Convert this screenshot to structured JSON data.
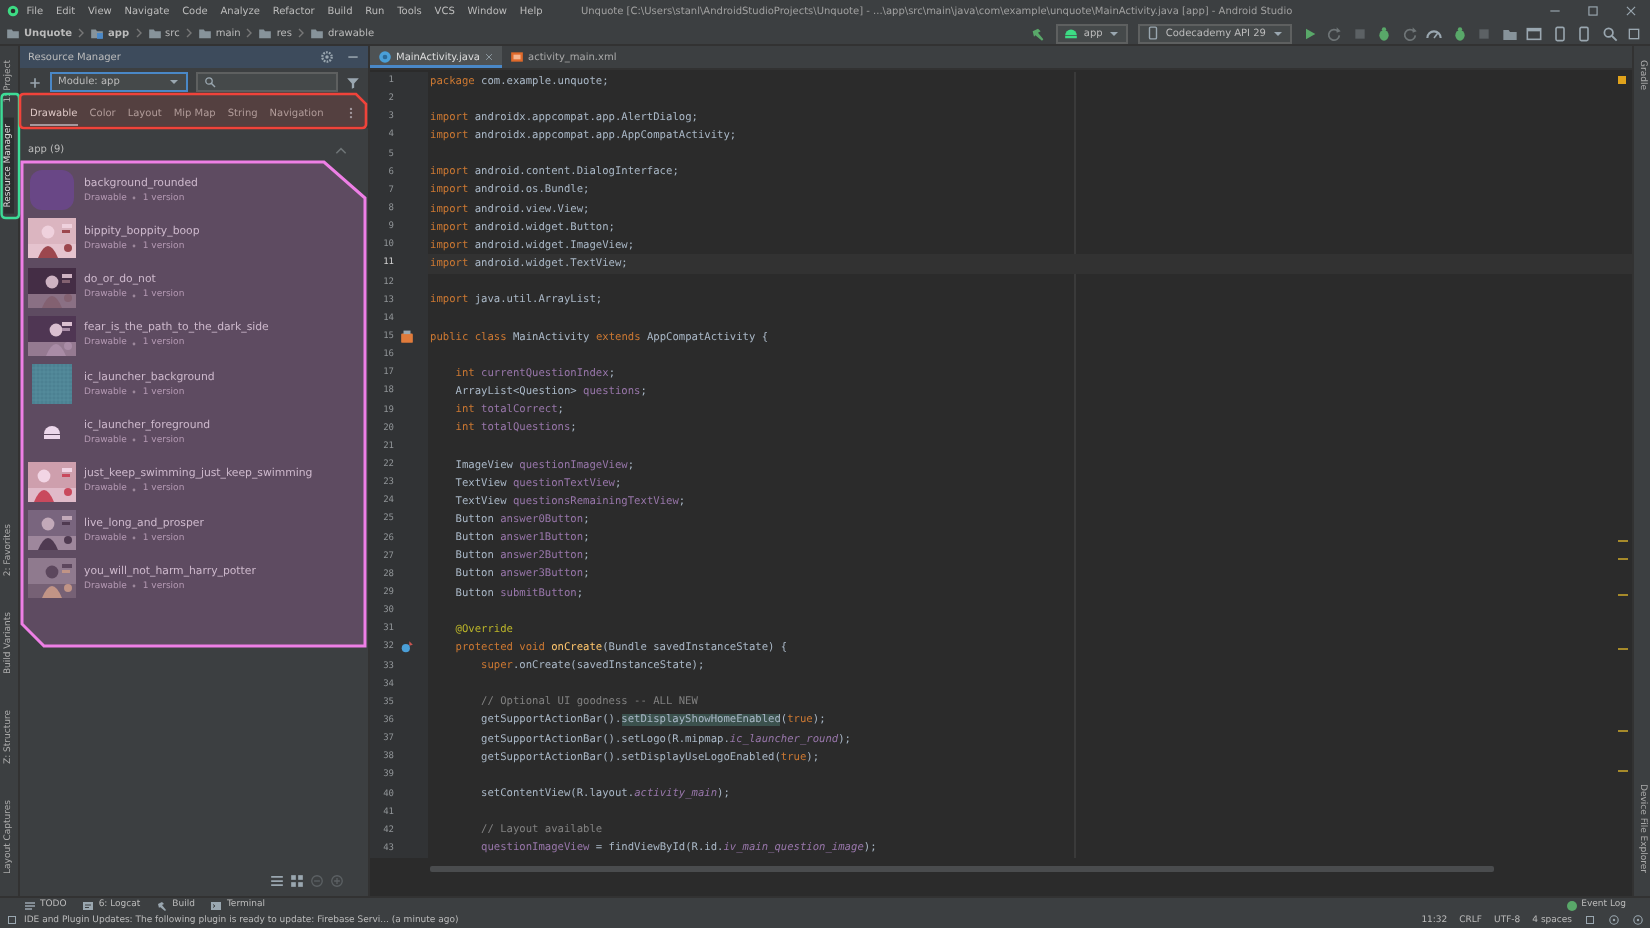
{
  "menu_bar": {
    "items": [
      "File",
      "Edit",
      "View",
      "Navigate",
      "Code",
      "Analyze",
      "Refactor",
      "Build",
      "Run",
      "Tools",
      "VCS",
      "Window",
      "Help"
    ],
    "title": "Unquote [C:\\Users\\stanl\\AndroidStudioProjects\\Unquote] - ...\\app\\src\\main\\java\\com\\example\\unquote\\MainActivity.java [app] - Android Studio"
  },
  "nav_bar": {
    "breadcrumbs": [
      {
        "label": "Unquote",
        "kind": "project"
      },
      {
        "label": "app",
        "kind": "module"
      },
      {
        "label": "src",
        "kind": "folder"
      },
      {
        "label": "main",
        "kind": "folder"
      },
      {
        "label": "res",
        "kind": "folder"
      },
      {
        "label": "drawable",
        "kind": "folder"
      }
    ],
    "run_config": "app",
    "device": "Codecademy API 29"
  },
  "left_tool_tabs": {
    "top": [
      {
        "label": "1: Project",
        "selected": false
      },
      {
        "label": "Resource Manager",
        "selected": true
      }
    ],
    "bottom": [
      {
        "label": "2: Favorites",
        "selected": false
      },
      {
        "label": "Build Variants",
        "selected": false
      },
      {
        "label": "Z: Structure",
        "selected": false
      },
      {
        "label": "Layout Captures",
        "selected": false
      }
    ]
  },
  "right_tool_tabs": {
    "top": [
      {
        "label": "Gradle"
      }
    ],
    "bottom": [
      {
        "label": "Device File Explorer"
      }
    ]
  },
  "resource_manager": {
    "title": "Resource Manager",
    "module": "Module: app",
    "tabs": [
      {
        "label": "Drawable",
        "selected": true
      },
      {
        "label": "Color",
        "selected": false
      },
      {
        "label": "Layout",
        "selected": false
      },
      {
        "label": "Mip Map",
        "selected": false
      },
      {
        "label": "String",
        "selected": false
      },
      {
        "label": "Navigation",
        "selected": false
      }
    ],
    "group": {
      "label": "app (9)",
      "expanded": true
    },
    "resources": [
      {
        "name": "background_rounded",
        "type": "Drawable",
        "versions": "1 version",
        "kind": "swatch"
      },
      {
        "name": "bippity_boppity_boop",
        "type": "Drawable",
        "versions": "1 version",
        "kind": "picture"
      },
      {
        "name": "do_or_do_not",
        "type": "Drawable",
        "versions": "1 version",
        "kind": "picture"
      },
      {
        "name": "fear_is_the_path_to_the_dark_side",
        "type": "Drawable",
        "versions": "1 version",
        "kind": "picture"
      },
      {
        "name": "ic_launcher_background",
        "type": "Drawable",
        "versions": "1 version",
        "kind": "grid"
      },
      {
        "name": "ic_launcher_foreground",
        "type": "Drawable",
        "versions": "1 version",
        "kind": "android"
      },
      {
        "name": "just_keep_swimming_just_keep_swimming",
        "type": "Drawable",
        "versions": "1 version",
        "kind": "picture"
      },
      {
        "name": "live_long_and_prosper",
        "type": "Drawable",
        "versions": "1 version",
        "kind": "picture"
      },
      {
        "name": "you_will_not_harm_harry_potter",
        "type": "Drawable",
        "versions": "1 version",
        "kind": "picture"
      }
    ]
  },
  "editor": {
    "tabs": [
      {
        "label": "MainActivity.java",
        "kind": "java",
        "selected": true
      },
      {
        "label": "activity_main.xml",
        "kind": "xml",
        "selected": false
      }
    ],
    "lines": [
      {
        "number": "1",
        "current": false,
        "segments": [
          {
            "kind": "keyword",
            "text": "package"
          },
          {
            "kind": "plain",
            "text": " com.example.unquote;"
          }
        ]
      },
      {
        "number": "2",
        "current": false
      },
      {
        "number": "3",
        "current": false,
        "segments": [
          {
            "kind": "keyword",
            "text": "import"
          },
          {
            "kind": "plain",
            "text": " androidx.appcompat.app.AlertDialog;"
          }
        ]
      },
      {
        "number": "4",
        "current": false,
        "segments": [
          {
            "kind": "keyword",
            "text": "import"
          },
          {
            "kind": "plain",
            "text": " androidx.appcompat.app.AppCompatActivity;"
          }
        ]
      },
      {
        "number": "5",
        "current": false
      },
      {
        "number": "6",
        "current": false,
        "segments": [
          {
            "kind": "keyword",
            "text": "import"
          },
          {
            "kind": "plain",
            "text": " android.content.DialogInterface;"
          }
        ]
      },
      {
        "number": "7",
        "current": false,
        "segments": [
          {
            "kind": "keyword",
            "text": "import"
          },
          {
            "kind": "plain",
            "text": " android.os.Bundle;"
          }
        ]
      },
      {
        "number": "8",
        "current": false,
        "segments": [
          {
            "kind": "keyword",
            "text": "import"
          },
          {
            "kind": "plain",
            "text": " android.view.View;"
          }
        ]
      },
      {
        "number": "9",
        "current": false,
        "segments": [
          {
            "kind": "keyword",
            "text": "import"
          },
          {
            "kind": "plain",
            "text": " android.widget.Button;"
          }
        ]
      },
      {
        "number": "10",
        "current": false,
        "segments": [
          {
            "kind": "keyword",
            "text": "import"
          },
          {
            "kind": "plain",
            "text": " android.widget.ImageView;"
          }
        ]
      },
      {
        "number": "11",
        "current": true,
        "segments": [
          {
            "kind": "keyword",
            "text": "import"
          },
          {
            "kind": "plain",
            "text": " android.widget.TextView;"
          }
        ]
      },
      {
        "number": "12",
        "current": false
      },
      {
        "number": "13",
        "current": false,
        "segments": [
          {
            "kind": "keyword",
            "text": "import"
          },
          {
            "kind": "plain",
            "text": " java.util.ArrayList;"
          }
        ]
      },
      {
        "number": "14",
        "current": false
      },
      {
        "number": "15",
        "current": false,
        "kind": "class",
        "segments": [
          {
            "kind": "keyword",
            "text": "public class"
          },
          {
            "kind": "plain",
            "text": " MainActivity "
          },
          {
            "kind": "keyword",
            "text": "extends"
          },
          {
            "kind": "plain",
            "text": " AppCompatActivity {"
          }
        ]
      },
      {
        "number": "16",
        "current": false
      },
      {
        "number": "17",
        "current": false,
        "segments": [
          {
            "kind": "keyword",
            "text": "    int"
          },
          {
            "kind": "field",
            "text": " currentQuestionIndex"
          },
          {
            "kind": "plain",
            "text": ";"
          }
        ]
      },
      {
        "number": "18",
        "current": false,
        "segments": [
          {
            "kind": "plain",
            "text": "    ArrayList<Question> "
          },
          {
            "kind": "field",
            "text": "questions"
          },
          {
            "kind": "plain",
            "text": ";"
          }
        ]
      },
      {
        "number": "19",
        "current": false,
        "segments": [
          {
            "kind": "keyword",
            "text": "    int"
          },
          {
            "kind": "field",
            "text": " totalCorrect"
          },
          {
            "kind": "plain",
            "text": ";"
          }
        ]
      },
      {
        "number": "20",
        "current": false,
        "segments": [
          {
            "kind": "keyword",
            "text": "    int"
          },
          {
            "kind": "field",
            "text": " totalQuestions"
          },
          {
            "kind": "plain",
            "text": ";"
          }
        ]
      },
      {
        "number": "21",
        "current": false
      },
      {
        "number": "22",
        "current": false,
        "segments": [
          {
            "kind": "plain",
            "text": "    ImageView "
          },
          {
            "kind": "field",
            "text": "questionImageView"
          },
          {
            "kind": "plain",
            "text": ";"
          }
        ]
      },
      {
        "number": "23",
        "current": false,
        "segments": [
          {
            "kind": "plain",
            "text": "    TextView "
          },
          {
            "kind": "field",
            "text": "questionTextView"
          },
          {
            "kind": "plain",
            "text": ";"
          }
        ]
      },
      {
        "number": "24",
        "current": false,
        "segments": [
          {
            "kind": "plain",
            "text": "    TextView "
          },
          {
            "kind": "field",
            "text": "questionsRemainingTextView"
          },
          {
            "kind": "plain",
            "text": ";"
          }
        ]
      },
      {
        "number": "25",
        "current": false,
        "segments": [
          {
            "kind": "plain",
            "text": "    Button "
          },
          {
            "kind": "field",
            "text": "answer0Button"
          },
          {
            "kind": "plain",
            "text": ";"
          }
        ]
      },
      {
        "number": "26",
        "current": false,
        "segments": [
          {
            "kind": "plain",
            "text": "    Button "
          },
          {
            "kind": "field",
            "text": "answer1Button"
          },
          {
            "kind": "plain",
            "text": ";"
          }
        ]
      },
      {
        "number": "27",
        "current": false,
        "segments": [
          {
            "kind": "plain",
            "text": "    Button "
          },
          {
            "kind": "field",
            "text": "answer2Button"
          },
          {
            "kind": "plain",
            "text": ";"
          }
        ]
      },
      {
        "number": "28",
        "current": false,
        "segments": [
          {
            "kind": "plain",
            "text": "    Button "
          },
          {
            "kind": "field",
            "text": "answer3Button"
          },
          {
            "kind": "plain",
            "text": ";"
          }
        ]
      },
      {
        "number": "29",
        "current": false,
        "segments": [
          {
            "kind": "plain",
            "text": "    Button "
          },
          {
            "kind": "field",
            "text": "submitButton"
          },
          {
            "kind": "plain",
            "text": ";"
          }
        ]
      },
      {
        "number": "30",
        "current": false
      },
      {
        "number": "31",
        "current": false,
        "segments": [
          {
            "kind": "annotation",
            "text": "    @Override"
          }
        ]
      },
      {
        "number": "32",
        "current": false,
        "kind": "override",
        "segments": [
          {
            "kind": "keyword",
            "text": "    protected void"
          },
          {
            "kind": "method",
            "text": " onCreate"
          },
          {
            "kind": "plain",
            "text": "(Bundle savedInstanceState) {"
          }
        ]
      },
      {
        "number": "33",
        "current": false,
        "segments": [
          {
            "kind": "keyword",
            "text": "        super"
          },
          {
            "kind": "plain",
            "text": ".onCreate(savedInstanceState);"
          }
        ]
      },
      {
        "number": "34",
        "current": false
      },
      {
        "number": "35",
        "current": false,
        "segments": [
          {
            "kind": "comment",
            "text": "        // Optional UI goodness -- ALL NEW"
          }
        ]
      },
      {
        "number": "36",
        "current": false,
        "segments": [
          {
            "kind": "plain",
            "text": "        getSupportActionBar()."
          },
          {
            "kind": "match",
            "text": "setDisplayShowHomeEnabled"
          },
          {
            "kind": "plain",
            "text": "("
          },
          {
            "kind": "keyword",
            "text": "true"
          },
          {
            "kind": "plain",
            "text": ");"
          }
        ]
      },
      {
        "number": "37",
        "current": false,
        "segments": [
          {
            "kind": "plain",
            "text": "        getSupportActionBar().setLogo(R.mipmap."
          },
          {
            "kind": "static",
            "text": "ic_launcher_round"
          },
          {
            "kind": "plain",
            "text": ");"
          }
        ]
      },
      {
        "number": "38",
        "current": false,
        "segments": [
          {
            "kind": "plain",
            "text": "        getSupportActionBar().setDisplayUseLogoEnabled("
          },
          {
            "kind": "keyword",
            "text": "true"
          },
          {
            "kind": "plain",
            "text": ");"
          }
        ]
      },
      {
        "number": "39",
        "current": false
      },
      {
        "number": "40",
        "current": false,
        "segments": [
          {
            "kind": "plain",
            "text": "        setContentView(R.layout."
          },
          {
            "kind": "static",
            "text": "activity_main"
          },
          {
            "kind": "plain",
            "text": ");"
          }
        ]
      },
      {
        "number": "41",
        "current": false
      },
      {
        "number": "42",
        "current": false,
        "segments": [
          {
            "kind": "comment",
            "text": "        // Layout available"
          }
        ]
      },
      {
        "number": "43",
        "current": false,
        "segments": [
          {
            "kind": "field",
            "text": "        questionImageView"
          },
          {
            "kind": "plain",
            "text": " = findViewById(R.id."
          },
          {
            "kind": "static",
            "text": "iv_main_question_image"
          },
          {
            "kind": "plain",
            "text": ");"
          }
        ]
      }
    ]
  },
  "bottom_tools": [
    {
      "label": "TODO",
      "kind": "todo"
    },
    {
      "label": "6: Logcat",
      "kind": "logcat"
    },
    {
      "label": "Build",
      "kind": "build"
    },
    {
      "label": "Terminal",
      "kind": "terminal"
    }
  ],
  "event_log": "Event Log",
  "status_bar": {
    "message": "IDE and Plugin Updates: The following plugin is ready to update: Firebase Servi... (a minute ago)",
    "position": "11:32",
    "line_separator": "CRLF",
    "encoding": "UTF-8",
    "indent": "4 spaces"
  }
}
